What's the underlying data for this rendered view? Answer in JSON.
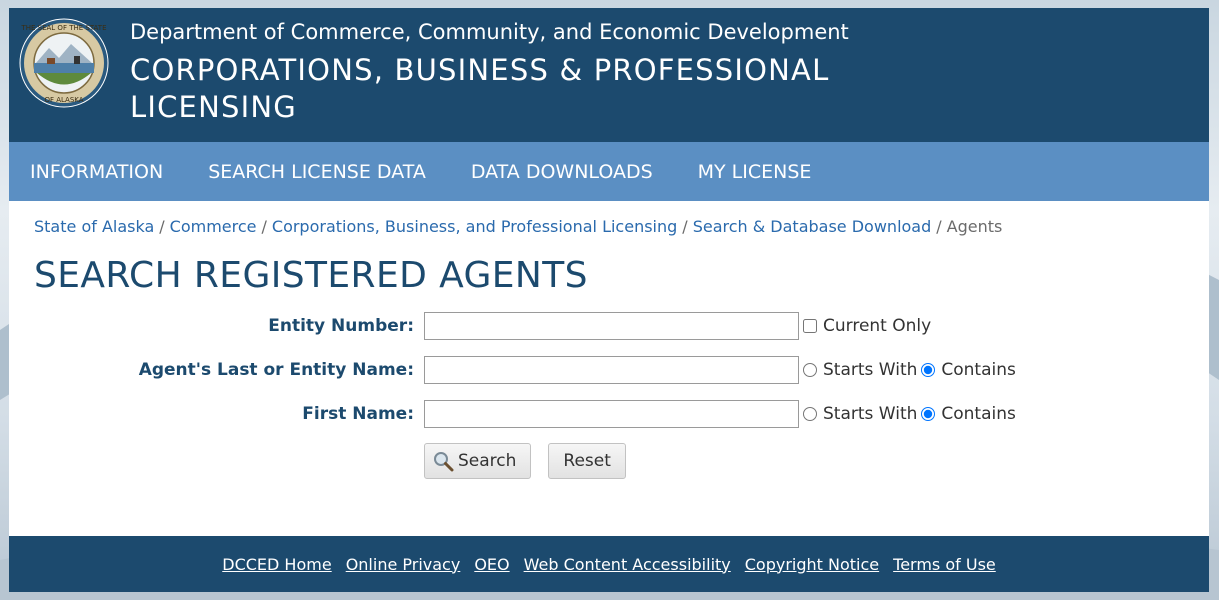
{
  "header": {
    "department": "Department of Commerce, Community, and Economic Development",
    "division": "CORPORATIONS, BUSINESS & PROFESSIONAL LICENSING",
    "seal_icon": "state-seal-icon"
  },
  "nav": {
    "items": [
      {
        "label": "INFORMATION"
      },
      {
        "label": "SEARCH LICENSE DATA"
      },
      {
        "label": "DATA DOWNLOADS"
      },
      {
        "label": "MY LICENSE"
      }
    ]
  },
  "breadcrumb": {
    "items": [
      {
        "label": "State of Alaska"
      },
      {
        "label": "Commerce"
      },
      {
        "label": "Corporations, Business, and Professional Licensing"
      },
      {
        "label": "Search & Database Download"
      }
    ],
    "current": "Agents",
    "separator": "/"
  },
  "page": {
    "title": "SEARCH REGISTERED AGENTS"
  },
  "form": {
    "entity_number": {
      "label": "Entity Number:",
      "value": "",
      "option_label": "Current Only",
      "checked": false
    },
    "agent_name": {
      "label": "Agent's Last or Entity Name:",
      "value": "",
      "opt_starts": "Starts With",
      "opt_contains": "Contains",
      "selected": "contains"
    },
    "first_name": {
      "label": "First Name:",
      "value": "",
      "opt_starts": "Starts With",
      "opt_contains": "Contains",
      "selected": "contains"
    },
    "search_label": "Search",
    "reset_label": "Reset"
  },
  "footer": {
    "links": [
      {
        "label": "DCCED Home"
      },
      {
        "label": "Online Privacy"
      },
      {
        "label": "OEO"
      },
      {
        "label": "Web Content Accessibility"
      },
      {
        "label": "Copyright Notice"
      },
      {
        "label": "Terms of Use"
      }
    ]
  },
  "colors": {
    "header_bg": "#1c4a6e",
    "nav_bg": "#5b8fc3",
    "link": "#2a6aad",
    "title": "#1c4a6e"
  }
}
